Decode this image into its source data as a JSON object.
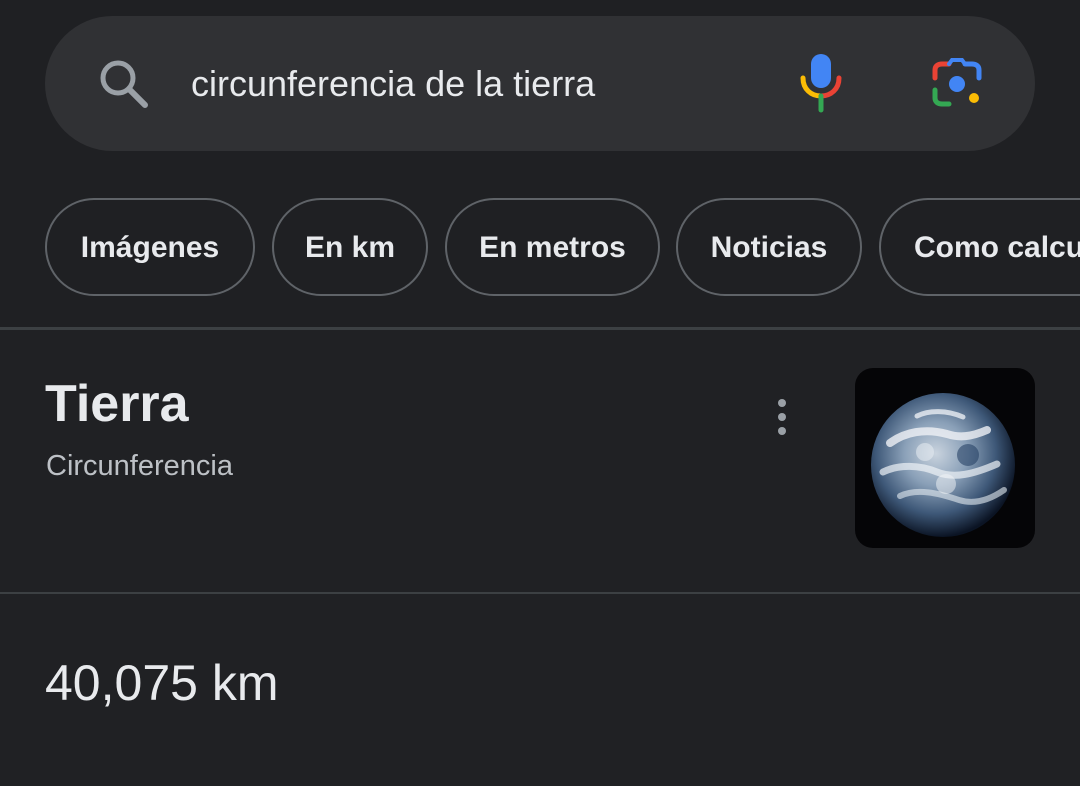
{
  "search": {
    "query": "circunferencia de la tierra",
    "icons": {
      "search": "search-icon",
      "voice": "mic-icon",
      "lens": "lens-icon"
    }
  },
  "chips": [
    {
      "label": "Imágenes"
    },
    {
      "label": "En km"
    },
    {
      "label": "En metros"
    },
    {
      "label": "Noticias"
    },
    {
      "label": "Como calcu"
    }
  ],
  "knowledge": {
    "title": "Tierra",
    "subtitle": "Circunferencia",
    "more_icon": "more-vert-icon",
    "image": "earth-image"
  },
  "answer": {
    "value": "40,075 km"
  },
  "colors": {
    "background": "#202124",
    "search_bar": "#303134",
    "chip_border": "#5f6368",
    "text": "#e8eaed",
    "secondary_text": "#bdc1c6",
    "google_blue": "#4285f4",
    "google_red": "#ea4335",
    "google_yellow": "#fbbc05",
    "google_green": "#34a853"
  }
}
